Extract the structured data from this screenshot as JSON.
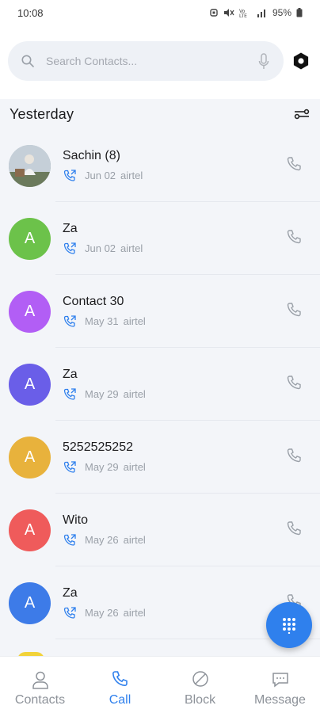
{
  "status_bar": {
    "time": "10:08",
    "battery": "95%"
  },
  "search": {
    "placeholder": "Search Contacts..."
  },
  "section": {
    "title": "Yesterday"
  },
  "calls": [
    {
      "name": "Sachin (8)",
      "date": "Jun 02",
      "carrier": "airtel",
      "avatar": "photo",
      "color": ""
    },
    {
      "name": "Za",
      "date": "Jun 02",
      "carrier": "airtel",
      "avatar": "A",
      "color": "#6cc24a"
    },
    {
      "name": "Contact 30",
      "date": "May 31",
      "carrier": "airtel",
      "avatar": "A",
      "color": "#b25ef5"
    },
    {
      "name": "Za",
      "date": "May 29",
      "carrier": "airtel",
      "avatar": "A",
      "color": "#6a5ee8"
    },
    {
      "name": "5252525252",
      "date": "May 29",
      "carrier": "airtel",
      "avatar": "A",
      "color": "#e8b23c"
    },
    {
      "name": "Wito",
      "date": "May 26",
      "carrier": "airtel",
      "avatar": "A",
      "color": "#ef5b5b"
    },
    {
      "name": "Za",
      "date": "May 26",
      "carrier": "airtel",
      "avatar": "A",
      "color": "#3d7be8"
    }
  ],
  "bottom_nav": [
    {
      "label": "Contacts",
      "icon": "person-icon",
      "active": false
    },
    {
      "label": "Call",
      "icon": "phone-icon",
      "active": true
    },
    {
      "label": "Block",
      "icon": "block-icon",
      "active": false
    },
    {
      "label": "Message",
      "icon": "message-icon",
      "active": false
    }
  ],
  "colors": {
    "accent": "#2f80ed",
    "list_background": "#f3f5f9",
    "search_background": "#eef1f6",
    "call_icon": "#2f80ed",
    "inactive_nav": "#8d9299"
  }
}
